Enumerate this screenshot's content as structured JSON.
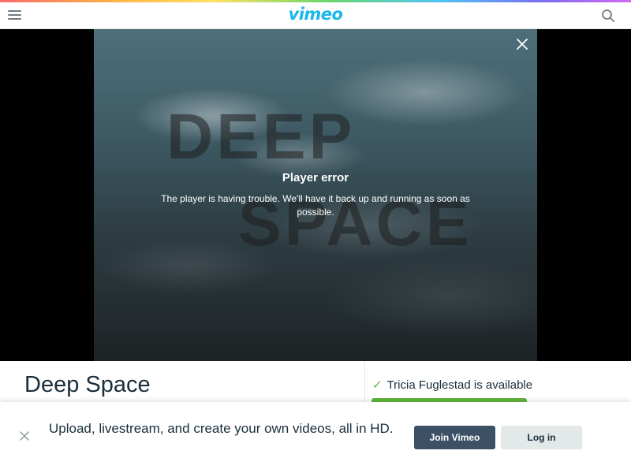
{
  "header": {
    "logo_text": "vimeo",
    "menu_icon": "hamburger-menu-icon",
    "search_icon": "search-icon",
    "brand_color": "#1ab7ea"
  },
  "player": {
    "video_title_art": [
      "DEEP",
      "SPACE"
    ],
    "error_title": "Player error",
    "error_message": "The player is having trouble. We'll have it back up and running as soon as possible.",
    "close_icon": "close-icon"
  },
  "video_info": {
    "title": "Deep Space"
  },
  "sidebar": {
    "availability": "Tricia Fuglestad is available",
    "status_icon": "checkmark-icon",
    "status_color": "#61b53b"
  },
  "signup_banner": {
    "message": "Upload, livestream, and create your own videos, all in HD.",
    "join_label": "Join Vimeo",
    "login_label": "Log in",
    "close_icon": "close-icon"
  }
}
